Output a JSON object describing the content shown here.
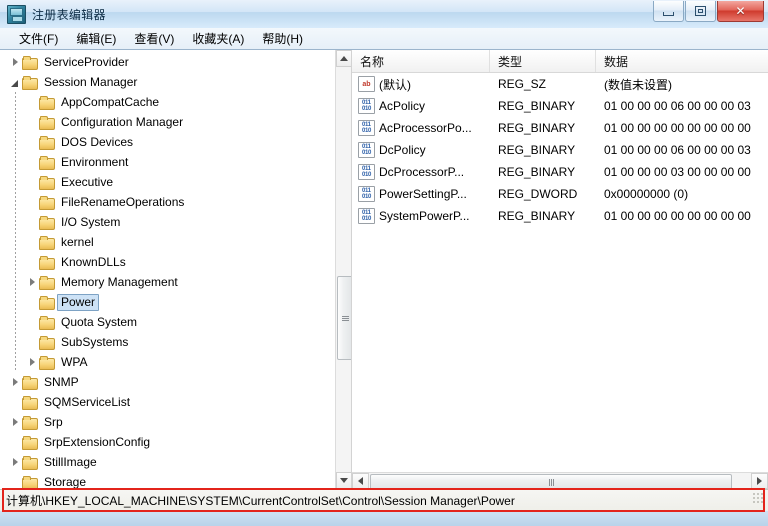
{
  "window": {
    "title": "注册表编辑器",
    "icon": "registry-editor-icon",
    "controls": {
      "minimize": "最小化",
      "maximize": "最大化",
      "close": "✕"
    }
  },
  "menubar": {
    "items": [
      {
        "label": "文件(F)"
      },
      {
        "label": "编辑(E)"
      },
      {
        "label": "查看(V)"
      },
      {
        "label": "收藏夹(A)"
      },
      {
        "label": "帮助(H)"
      }
    ]
  },
  "tree": {
    "selected": "Power",
    "nodes": [
      {
        "label": "ServiceProvider",
        "depth": 4,
        "arrow": "collapsed",
        "selected": false
      },
      {
        "label": "Session Manager",
        "depth": 4,
        "arrow": "expanded",
        "selected": false
      },
      {
        "label": "AppCompatCache",
        "depth": 5,
        "arrow": "none",
        "selected": false
      },
      {
        "label": "Configuration Manager",
        "depth": 5,
        "arrow": "none",
        "selected": false
      },
      {
        "label": "DOS Devices",
        "depth": 5,
        "arrow": "none",
        "selected": false
      },
      {
        "label": "Environment",
        "depth": 5,
        "arrow": "none",
        "selected": false
      },
      {
        "label": "Executive",
        "depth": 5,
        "arrow": "none",
        "selected": false
      },
      {
        "label": "FileRenameOperations",
        "depth": 5,
        "arrow": "none",
        "selected": false
      },
      {
        "label": "I/O System",
        "depth": 5,
        "arrow": "none",
        "selected": false
      },
      {
        "label": "kernel",
        "depth": 5,
        "arrow": "none",
        "selected": false
      },
      {
        "label": "KnownDLLs",
        "depth": 5,
        "arrow": "none",
        "selected": false
      },
      {
        "label": "Memory Management",
        "depth": 5,
        "arrow": "collapsed",
        "selected": false
      },
      {
        "label": "Power",
        "depth": 5,
        "arrow": "none",
        "selected": true
      },
      {
        "label": "Quota System",
        "depth": 5,
        "arrow": "none",
        "selected": false
      },
      {
        "label": "SubSystems",
        "depth": 5,
        "arrow": "none",
        "selected": false
      },
      {
        "label": "WPA",
        "depth": 5,
        "arrow": "collapsed",
        "selected": false
      },
      {
        "label": "SNMP",
        "depth": 4,
        "arrow": "collapsed",
        "selected": false
      },
      {
        "label": "SQMServiceList",
        "depth": 4,
        "arrow": "none",
        "selected": false
      },
      {
        "label": "Srp",
        "depth": 4,
        "arrow": "collapsed",
        "selected": false
      },
      {
        "label": "SrpExtensionConfig",
        "depth": 4,
        "arrow": "none",
        "selected": false
      },
      {
        "label": "StillImage",
        "depth": 4,
        "arrow": "collapsed",
        "selected": false
      },
      {
        "label": "Storage",
        "depth": 4,
        "arrow": "none",
        "selected": false
      }
    ]
  },
  "values": {
    "columns": {
      "name": "名称",
      "type": "类型",
      "data": "数据"
    },
    "rows": [
      {
        "icon": "string-value-icon",
        "kind": "str",
        "name": "(默认)",
        "type": "REG_SZ",
        "data": "(数值未设置)"
      },
      {
        "icon": "binary-value-icon",
        "kind": "bin",
        "name": "AcPolicy",
        "type": "REG_BINARY",
        "data": "01 00 00 00 06 00 00 00 03"
      },
      {
        "icon": "binary-value-icon",
        "kind": "bin",
        "name": "AcProcessorPo...",
        "type": "REG_BINARY",
        "data": "01 00 00 00 00 00 00 00 00"
      },
      {
        "icon": "binary-value-icon",
        "kind": "bin",
        "name": "DcPolicy",
        "type": "REG_BINARY",
        "data": "01 00 00 00 06 00 00 00 03"
      },
      {
        "icon": "binary-value-icon",
        "kind": "bin",
        "name": "DcProcessorP...",
        "type": "REG_BINARY",
        "data": "01 00 00 00 03 00 00 00 00"
      },
      {
        "icon": "binary-value-icon",
        "kind": "bin",
        "name": "PowerSettingP...",
        "type": "REG_DWORD",
        "data": "0x00000000 (0)"
      },
      {
        "icon": "binary-value-icon",
        "kind": "bin",
        "name": "SystemPowerP...",
        "type": "REG_BINARY",
        "data": "01 00 00 00 00 00 00 00 00"
      }
    ]
  },
  "statusbar": {
    "path": "计算机\\HKEY_LOCAL_MACHINE\\SYSTEM\\CurrentControlSet\\Control\\Session Manager\\Power"
  },
  "annotation": {
    "color": "#e3241b"
  }
}
